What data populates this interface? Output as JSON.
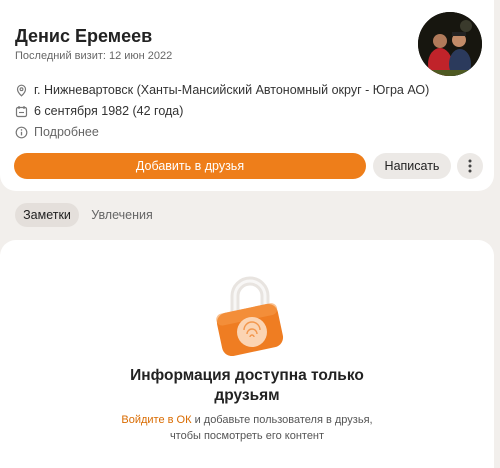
{
  "profile": {
    "name": "Денис Еремеев",
    "last_visit": "Последний визит: 12 июн 2022",
    "location": "г. Нижневартовск (Ханты-Мансийский Автономный округ - Югра АО)",
    "birthday": "6 сентября 1982 (42 года)",
    "more": "Подробнее"
  },
  "actions": {
    "add_friend": "Добавить в друзья",
    "message": "Написать"
  },
  "tabs": [
    {
      "label": "Заметки",
      "active": true
    },
    {
      "label": "Увлечения",
      "active": false
    }
  ],
  "private": {
    "title_line1": "Информация доступна только",
    "title_line2": "друзьям",
    "login_link": "Войдите в ОК",
    "sub_line1_rest": " и добавьте пользователя в друзья,",
    "sub_line2": "чтобы посмотреть его контент"
  },
  "colors": {
    "accent": "#ee7e1a",
    "link": "#d96b00",
    "background": "#f2efec"
  },
  "icons": [
    "location-pin-icon",
    "calendar-icon",
    "info-icon",
    "more-dots-icon",
    "padlock-icon"
  ]
}
